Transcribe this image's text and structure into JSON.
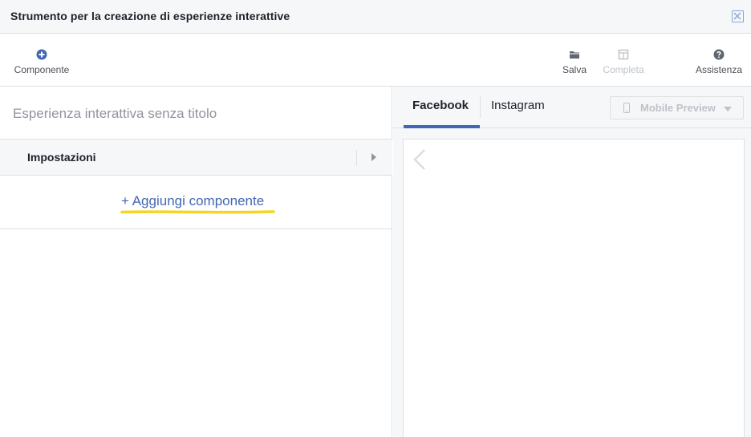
{
  "window": {
    "title": "Strumento per la creazione di esperienze interattive"
  },
  "toolbar": {
    "componente": {
      "label": "Componente",
      "icon": "plus-circle-icon",
      "color": "#4267b2"
    },
    "salva": {
      "label": "Salva",
      "icon": "folder-icon"
    },
    "completa": {
      "label": "Completa",
      "icon": "layout-icon",
      "disabled": true
    },
    "assistenza": {
      "label": "Assistenza",
      "icon": "help-icon"
    }
  },
  "editor": {
    "experience_title_placeholder": "Esperienza interattiva senza titolo",
    "settings_label": "Impostazioni",
    "add_component_label": "+ Aggiungi componente"
  },
  "preview": {
    "tabs": [
      {
        "label": "Facebook",
        "active": true
      },
      {
        "label": "Instagram",
        "active": false
      }
    ],
    "mode_button_label": "Mobile Preview"
  },
  "colors": {
    "accent": "#4267b2",
    "highlight": "#f7d41f",
    "disabled": "#bec3c9"
  }
}
